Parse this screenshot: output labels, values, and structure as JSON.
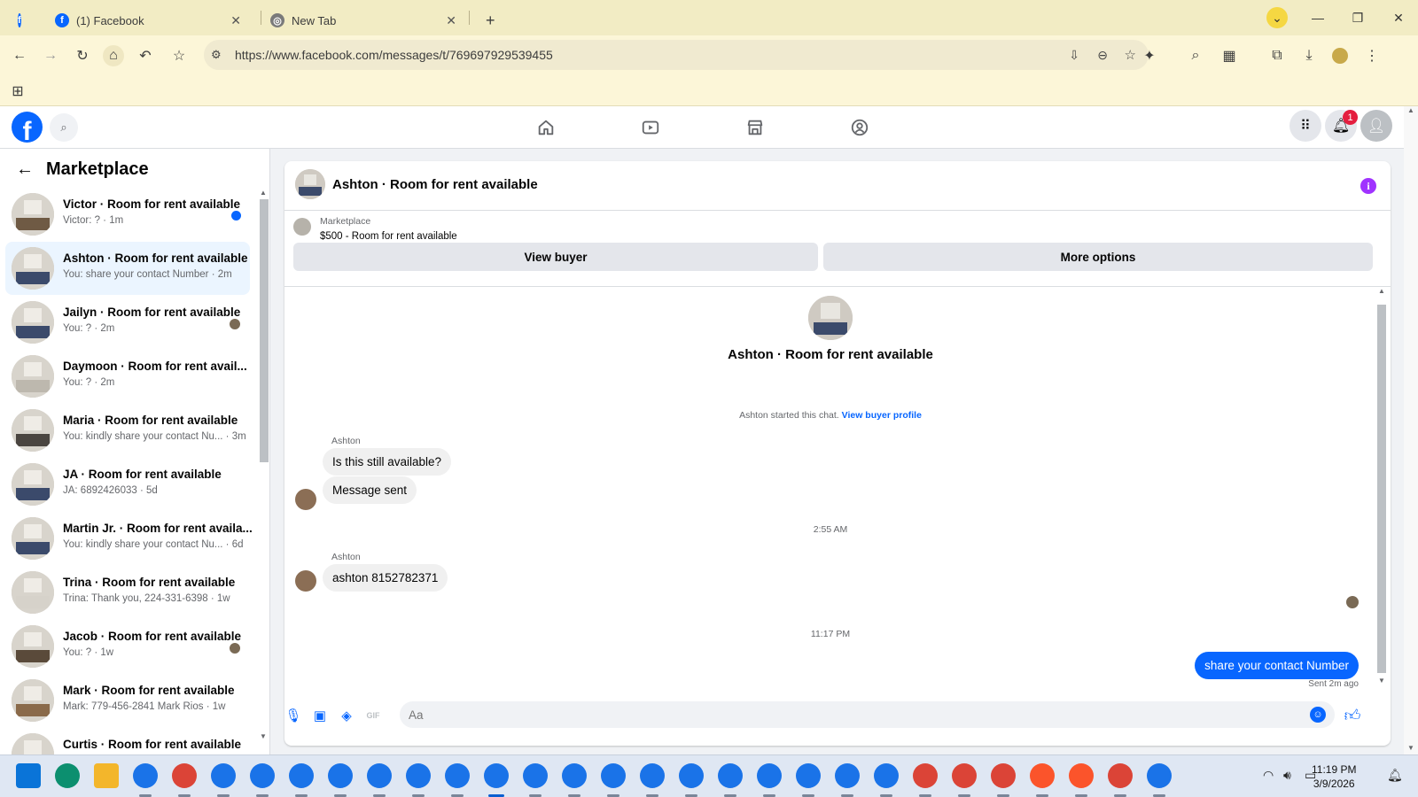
{
  "browser": {
    "tabs": [
      {
        "title": "(1) Facebook",
        "active": true
      },
      {
        "title": "New Tab",
        "active": false
      }
    ],
    "new_tab_label": "+",
    "url": "https://www.facebook.com/messages/t/769697929539455"
  },
  "fb_header": {
    "logo_letter": "f",
    "notification_count": "1"
  },
  "sidebar": {
    "title": "Marketplace",
    "conversations": [
      {
        "name": "Victor · Room for rent available",
        "preview": "Victor: ? · 1m",
        "status": "unread"
      },
      {
        "name": "Ashton · Room for rent available",
        "preview": "You: share your contact Number · 2m",
        "status": "active"
      },
      {
        "name": "Jailyn · Room for rent available",
        "preview": "You: ? · 2m",
        "status": "seen"
      },
      {
        "name": "Daymoon · Room for rent avail...",
        "preview": "You: ? · 2m",
        "status": "none"
      },
      {
        "name": "Maria · Room for rent available",
        "preview": "You: kindly share your contact Nu... · 3m",
        "status": "none"
      },
      {
        "name": "JA · Room for rent available",
        "preview": "JA: 6892426033 · 5d",
        "status": "none"
      },
      {
        "name": "Martin Jr. · Room for rent availa...",
        "preview": "You: kindly share your contact Nu... · 6d",
        "status": "none"
      },
      {
        "name": "Trina · Room for rent available",
        "preview": "Trina: Thank you, 224-331-6398 · 1w",
        "status": "none"
      },
      {
        "name": "Jacob · Room for rent available",
        "preview": "You: ? · 1w",
        "status": "seen"
      },
      {
        "name": "Mark · Room for rent available",
        "preview": "Mark: 779-456-2841 Mark Rios · 1w",
        "status": "none"
      },
      {
        "name": "Curtis · Room for rent available",
        "preview": "",
        "status": "none"
      }
    ]
  },
  "chat": {
    "title": "Ashton · Room for rent available",
    "marketplace_label": "Marketplace",
    "listing": "$500 - Room for rent available",
    "view_buyer_label": "View buyer",
    "more_options_label": "More options",
    "intro_name": "Ashton · Room for rent available",
    "system_text": "Ashton started this chat.",
    "system_link": "View buyer profile",
    "messages": [
      {
        "sender": "Ashton",
        "text": "Is this still available?"
      },
      {
        "sender": "",
        "text": "Message sent"
      },
      {
        "timestamp": "2:55 AM"
      },
      {
        "sender": "Ashton",
        "text": "ashton 8152782371"
      },
      {
        "timestamp": "11:17 PM"
      },
      {
        "sender": "You",
        "text": "share your contact Number"
      }
    ],
    "sent_note": "Sent 2m ago",
    "composer_placeholder": "Aa"
  },
  "taskbar": {
    "time": "11:19 PM",
    "date": "3/9/2026"
  },
  "colors": {
    "fb_blue": "#0866ff",
    "active_conv": "#ebf5ff",
    "chrome_tabbar": "#f2ecc4",
    "info_purple": "#a033ff",
    "badge_red": "#e41e3f"
  }
}
